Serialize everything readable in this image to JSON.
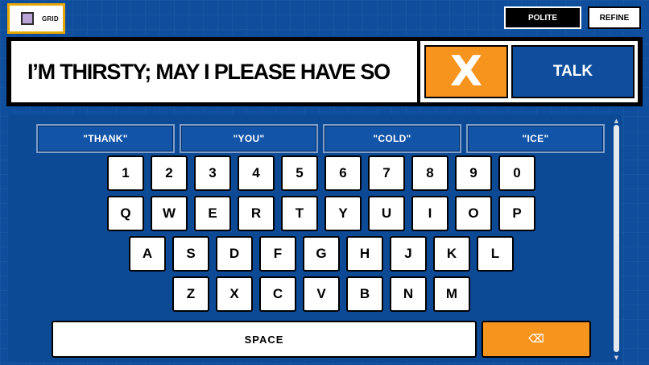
{
  "top_bar": {
    "grid_label": "GRID",
    "polite_label": "POLITE",
    "refine_label": "REFINE"
  },
  "message": {
    "text": "I’M THIRSTY; MAY I PLEASE HAVE SO",
    "clear_label": "X",
    "talk_label": "TALK"
  },
  "suggestions": [
    "\"THANK\"",
    "\"YOU\"",
    "\"COLD\"",
    "\"ICE\""
  ],
  "keyboard": {
    "row1": [
      "1",
      "2",
      "3",
      "4",
      "5",
      "6",
      "7",
      "8",
      "9",
      "0"
    ],
    "row2": [
      "Q",
      "W",
      "E",
      "R",
      "T",
      "Y",
      "U",
      "I",
      "O",
      "P"
    ],
    "row3": [
      "A",
      "S",
      "D",
      "F",
      "G",
      "H",
      "J",
      "K",
      "L"
    ],
    "row4": [
      "Z",
      "X",
      "C",
      "V",
      "B",
      "N",
      "M"
    ],
    "space_label": "SPACE",
    "backspace_icon": "⌫"
  },
  "scrollbar": {
    "up_icon": "▲",
    "down_icon": "▼"
  },
  "colors": {
    "background": "#0e4e9c",
    "accent_orange": "#f7941d",
    "grid_button_border": "#e8a700"
  }
}
